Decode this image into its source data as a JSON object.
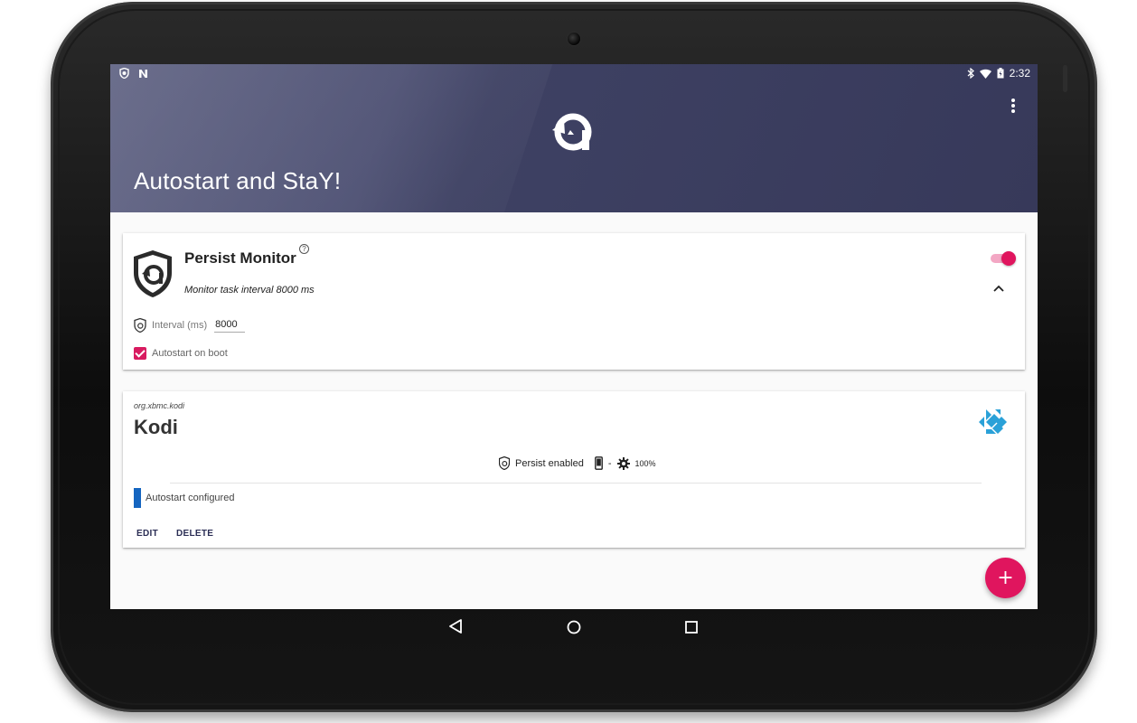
{
  "status_bar": {
    "time": "2:32",
    "left_icons": [
      "shield-notification-icon",
      "n-notification-icon"
    ],
    "right_icons": [
      "bluetooth-icon",
      "wifi-icon",
      "battery-icon"
    ]
  },
  "app_bar": {
    "title": "Autostart and StaY!",
    "menu_icon": "overflow-menu-icon"
  },
  "persist_monitor": {
    "title": "Persist Monitor",
    "help_glyph": "?",
    "subtitle": "Monitor task interval 8000 ms",
    "enabled": true,
    "interval_label": "Interval (ms)",
    "interval_value": "8000",
    "autostart_label": "Autostart on boot",
    "autostart_checked": true
  },
  "app_card": {
    "package": "org.xbmc.kodi",
    "name": "Kodi",
    "persist_status": "Persist enabled",
    "separator": "-",
    "level": "100%",
    "autostart_status": "Autostart configured",
    "edit_label": "EDIT",
    "delete_label": "DELETE"
  },
  "fab": {
    "label": "+"
  },
  "colors": {
    "accent": "#e0155e",
    "appbar": "#3e4163",
    "autostart_bar": "#1565c0",
    "kodi_blue": "#2aa1d8"
  }
}
